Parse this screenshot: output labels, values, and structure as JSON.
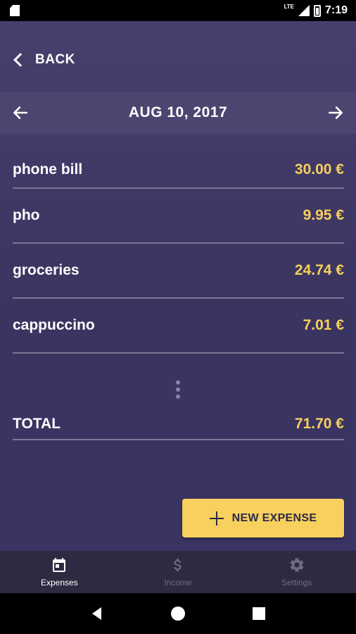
{
  "status_bar": {
    "time": "7:19",
    "network": "LTE"
  },
  "header": {
    "back_label": "BACK"
  },
  "date_bar": {
    "date": "AUG 10, 2017"
  },
  "expenses": [
    {
      "name": "phone bill",
      "amount": "30.00 €"
    },
    {
      "name": "pho",
      "amount": "9.95 €"
    },
    {
      "name": "groceries",
      "amount": "24.74 €"
    },
    {
      "name": "cappuccino",
      "amount": "7.01 €"
    }
  ],
  "total": {
    "label": "TOTAL",
    "amount": "71.70 €"
  },
  "fab": {
    "label": "NEW EXPENSE"
  },
  "bottom_nav": {
    "items": [
      {
        "label": "Expenses",
        "icon": "calendar-icon",
        "active": true
      },
      {
        "label": "Income",
        "icon": "dollar-icon",
        "active": false
      },
      {
        "label": "Settings",
        "icon": "gear-icon",
        "active": false
      }
    ]
  },
  "colors": {
    "background": "#3d3660",
    "accent_yellow": "#f7d05e",
    "amount_text": "#f7cf5c",
    "nav_background": "#2e2a41"
  }
}
